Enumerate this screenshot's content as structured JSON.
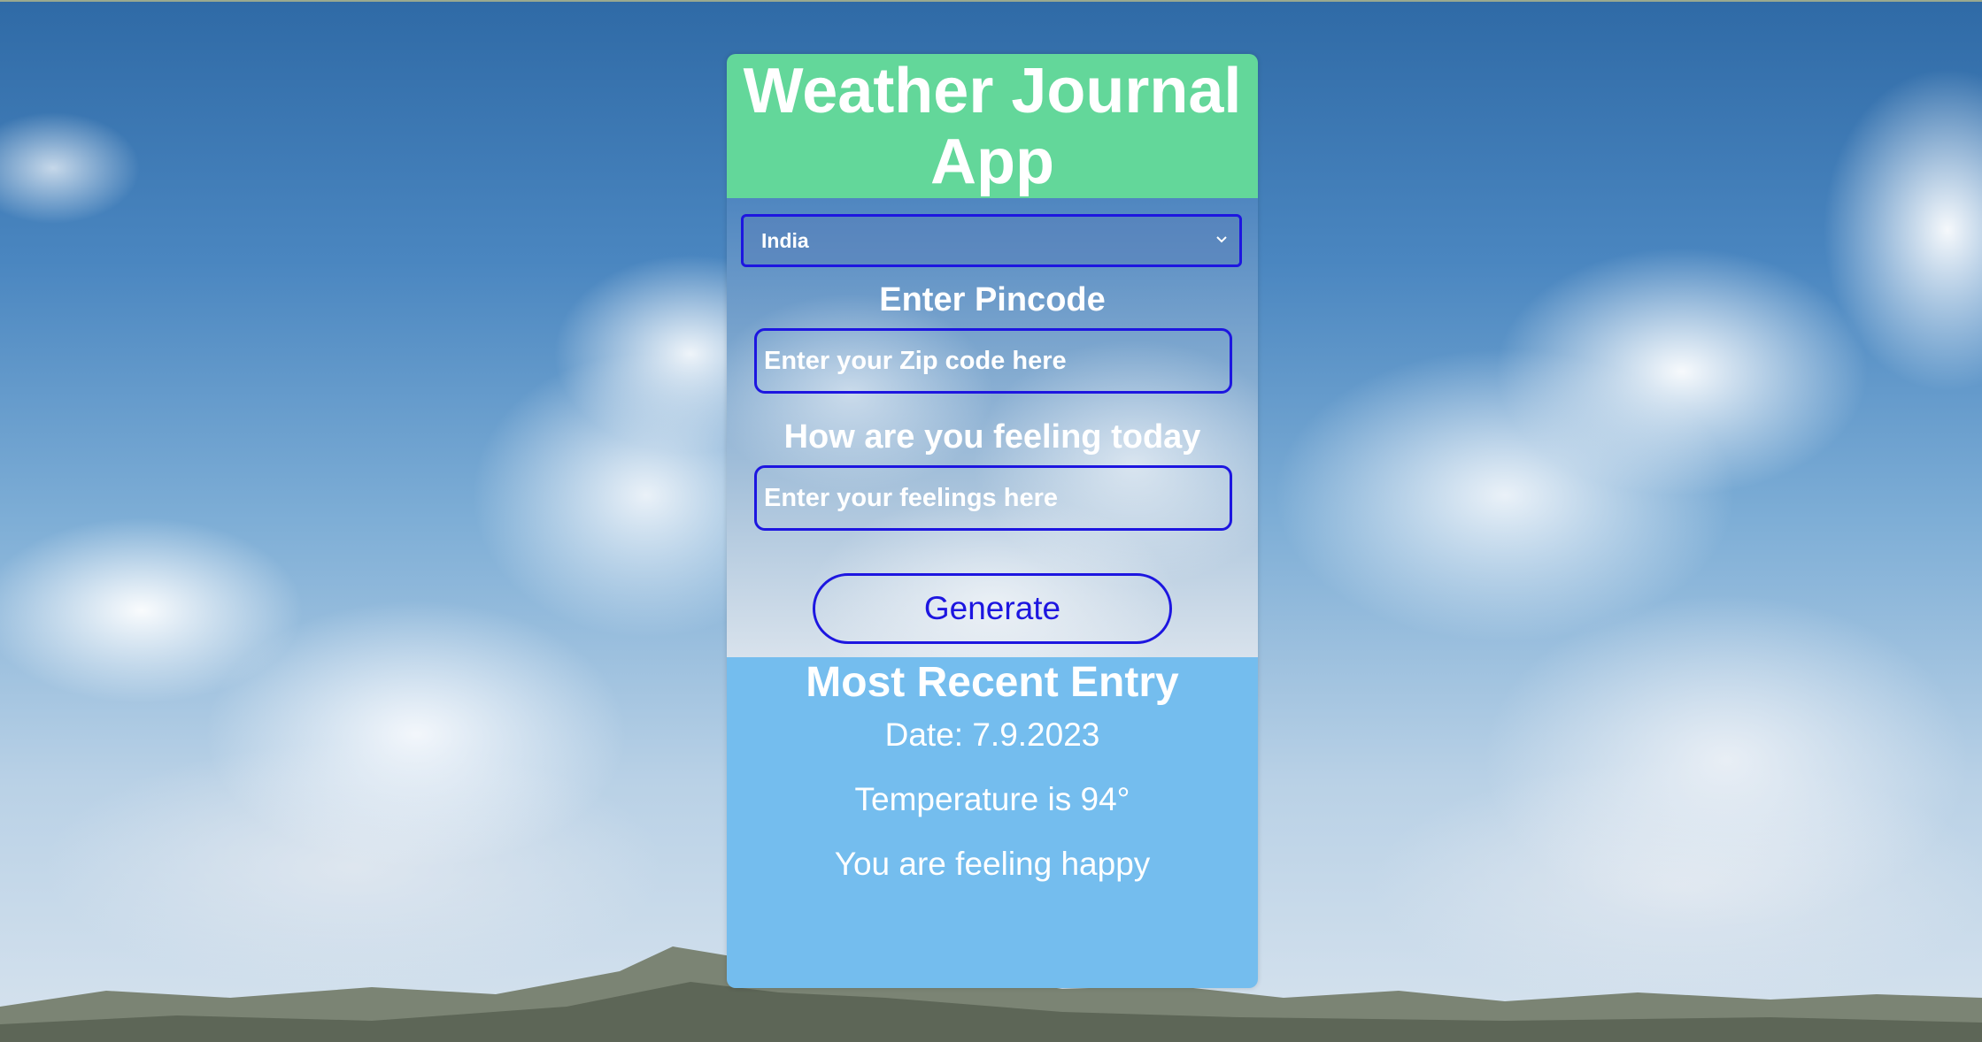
{
  "app": {
    "title": "Weather Journal App"
  },
  "form": {
    "country_selected": "India",
    "pincode_label": "Enter Pincode",
    "zip_placeholder": "Enter your Zip code here",
    "feelings_label": "How are you feeling today",
    "feelings_placeholder": "Enter your feelings here",
    "generate_label": "Generate"
  },
  "entry": {
    "heading": "Most Recent Entry",
    "date": "Date: 7.9.2023",
    "temperature": "Temperature is 94°",
    "feeling": "You are feeling happy"
  },
  "colors": {
    "header_bg": "#63d79a",
    "entry_bg": "#74bdee",
    "accent_border": "#1d16e0"
  },
  "icons": {
    "select_arrow": "chevron-down-icon"
  }
}
